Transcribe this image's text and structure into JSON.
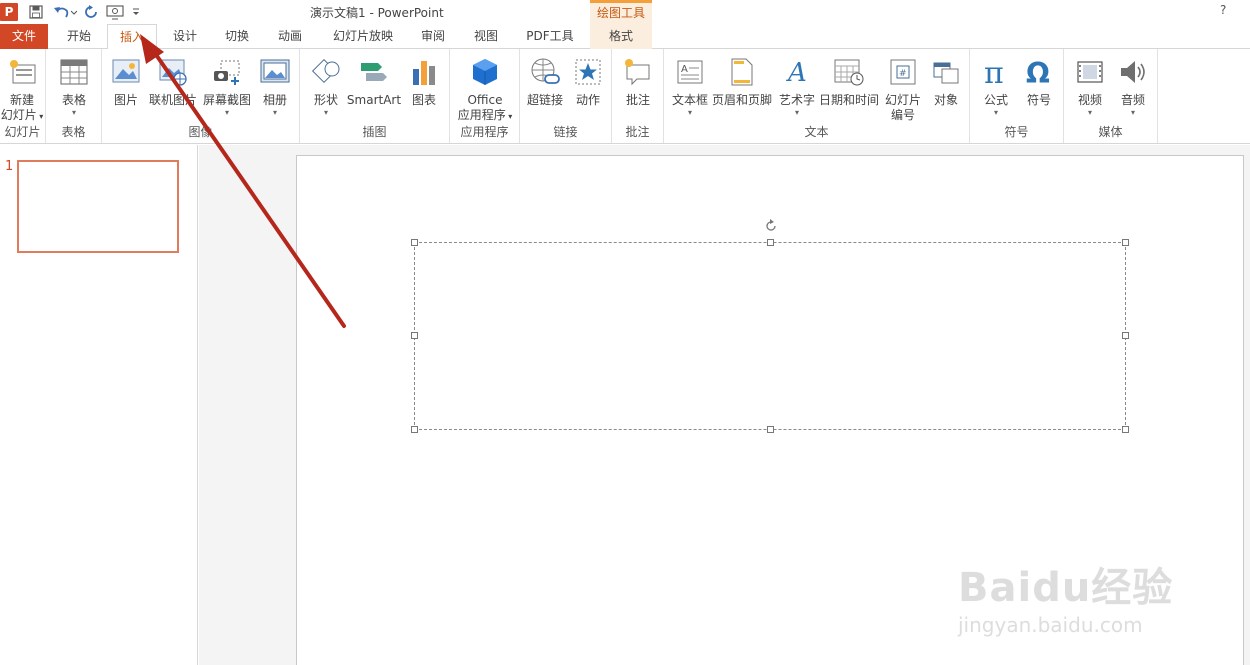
{
  "titlebar": {
    "doc_title": "演示文稿1 - PowerPoint",
    "context_tool": "绘图工具",
    "help": "?",
    "qat_icons": [
      "powerpoint-icon",
      "save-icon",
      "undo-icon",
      "redo-icon",
      "slideshow-from-start-icon",
      "customize-qat-icon"
    ]
  },
  "tabs": {
    "file": "文件",
    "home": "开始",
    "insert": "插入",
    "design": "设计",
    "transitions": "切换",
    "animations": "动画",
    "slideshow": "幻灯片放映",
    "review": "审阅",
    "view": "视图",
    "pdf": "PDF工具",
    "format": "格式"
  },
  "ribbon": {
    "slides": {
      "label": "幻灯片",
      "new_slide_1": "新建",
      "new_slide_2": "幻灯片"
    },
    "tables": {
      "label": "表格",
      "table": "表格"
    },
    "images": {
      "label": "图像",
      "picture": "图片",
      "online_picture": "联机图片",
      "screenshot": "屏幕截图",
      "album": "相册"
    },
    "illustrations": {
      "label": "插图",
      "shapes": "形状",
      "smartart": "SmartArt",
      "chart": "图表"
    },
    "apps": {
      "label": "应用程序",
      "office_1": "Office",
      "office_2": "应用程序"
    },
    "links": {
      "label": "链接",
      "hyperlink": "超链接",
      "action": "动作"
    },
    "comments": {
      "label": "批注",
      "comment": "批注"
    },
    "text": {
      "label": "文本",
      "textbox": "文本框",
      "header_footer": "页眉和页脚",
      "wordart": "艺术字",
      "datetime": "日期和时间",
      "slide_number_1": "幻灯片",
      "slide_number_2": "编号",
      "object": "对象"
    },
    "symbols": {
      "label": "符号",
      "equation": "公式",
      "symbol": "符号"
    },
    "media": {
      "label": "媒体",
      "video": "视频",
      "audio": "音频"
    }
  },
  "thumbnails": {
    "slide_number": "1"
  },
  "watermark": {
    "main": "Baidu经验",
    "sub": "jingyan.baidu.com"
  },
  "colors": {
    "accent": "#d24726",
    "context": "#c55a11",
    "annotation_arrow": "#b5271b"
  }
}
